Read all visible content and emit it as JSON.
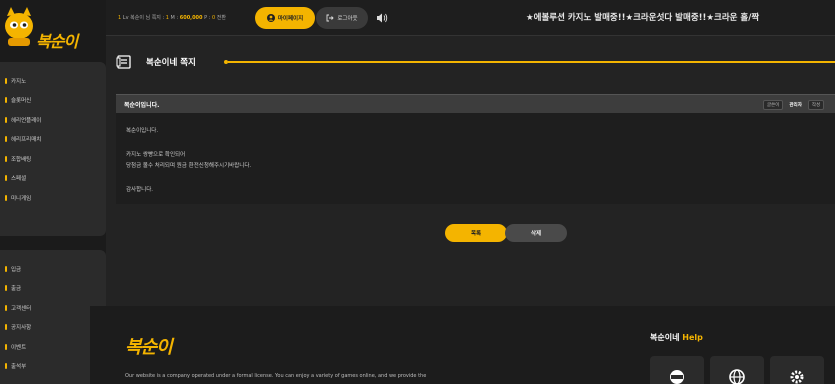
{
  "brand": {
    "logo_text": "복순이"
  },
  "sidebar": {
    "menu_top": [
      "카지노",
      "슬롯머신",
      "헤리언플레이",
      "헤리프리매치",
      "조합배팅",
      "스페셜",
      "미니게임"
    ],
    "menu_bottom": [
      "입금",
      "출금",
      "고객센터",
      "공지사항",
      "이벤트",
      "출석부"
    ]
  },
  "header": {
    "level": "1",
    "user_text": "Lv 복순이 님 쪽지 :",
    "note_count": "1",
    "money_label": "M :",
    "money_value": "600,000",
    "point_label": "P :",
    "point_value": "0",
    "point_unit": "전환",
    "mypage_label": "마이페이지",
    "logout_label": "로그아웃",
    "ticker": "★에볼루션 카지노 발매중!!★크라운섯다 발매중!!★크라운 홀/짝"
  },
  "page": {
    "title": "복순이네 쪽지"
  },
  "post": {
    "title": "복순이입니다.",
    "author_tag": "글쓴이",
    "author_name": "관리자",
    "author_extra": "작성",
    "body": {
      "line1": "복순이입니다.",
      "line2": "카지노 쌍빵으로 확인되어",
      "line3": "당첨금 몰수 처리되며 원금 환전신청해주시기바랍니다.",
      "line4": "감사합니다."
    }
  },
  "buttons": {
    "list": "목록",
    "delete": "삭제"
  },
  "footer": {
    "logo_text": "복순이",
    "description": "Our website is a company operated under a formal license. You can enjoy a variety of games online, and we provide the",
    "help_title_main": "복순이네",
    "help_title_accent": "Help"
  },
  "colors": {
    "accent": "#f4b400",
    "background": "#232323",
    "panel": "#2b2b2b"
  },
  "icons": [
    "mascot-icon",
    "user-icon",
    "logout-icon",
    "speaker-icon",
    "note-icon",
    "support-icon",
    "globe-icon",
    "gear-icon"
  ]
}
